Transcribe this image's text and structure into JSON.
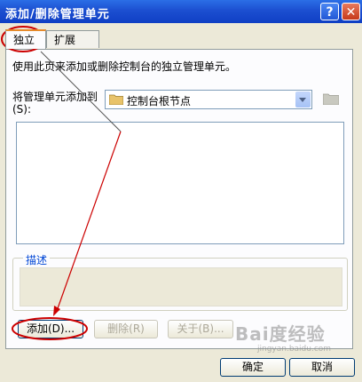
{
  "window": {
    "title": "添加/删除管理单元",
    "help_label": "?",
    "close_label": "✕"
  },
  "tabs": [
    {
      "label": "独立"
    },
    {
      "label": "扩展"
    }
  ],
  "intro_text": "使用此页来添加或删除控制台的独立管理单元。",
  "add_to": {
    "label": "将管理单元添加到(S):",
    "value": "控制台根节点"
  },
  "description": {
    "title": "描述"
  },
  "buttons": {
    "add": "添加(D)...",
    "remove": "删除(R)",
    "about": "关于(B)...",
    "ok": "确定",
    "cancel": "取消"
  },
  "watermark": {
    "text": "Bai度经验",
    "sub": "jingyan.baidu.com"
  },
  "colors": {
    "annotation": "#cc0000",
    "titlebar": "#1c4fd1"
  }
}
